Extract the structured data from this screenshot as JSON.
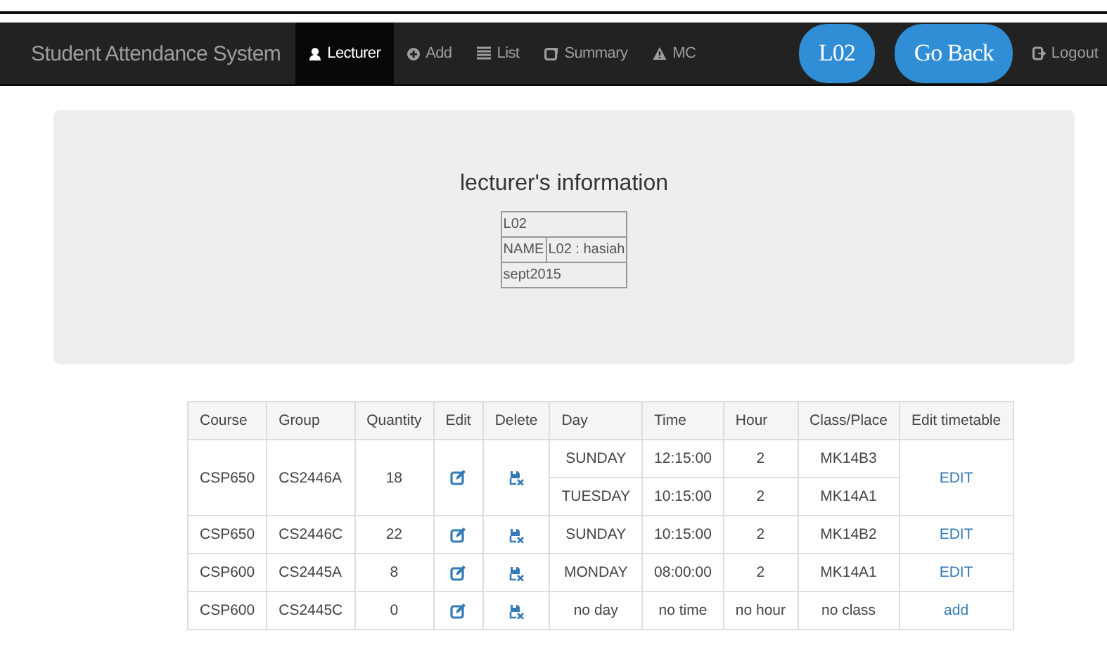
{
  "navbar": {
    "brand": "Student Attendance System",
    "items": [
      {
        "label": "Lecturer",
        "selected": true
      },
      {
        "label": "Add",
        "selected": false
      },
      {
        "label": "List",
        "selected": false
      },
      {
        "label": "Summary",
        "selected": false
      },
      {
        "label": "MC",
        "selected": false
      }
    ],
    "buttons": [
      "L02",
      "Go Back"
    ],
    "logout": "Logout"
  },
  "info": {
    "title": "lecturer's information",
    "id": "L02",
    "name_label": "NAME",
    "name_value": "L02 : hasiah",
    "session": "sept2015"
  },
  "table": {
    "columns": [
      "Course",
      "Group",
      "Quantity",
      "Edit",
      "Delete",
      "Day",
      "Time",
      "Hour",
      "Class/Place",
      "Edit timetable"
    ],
    "rows": [
      {
        "course": "CSP650",
        "group": "CS2446A",
        "quantity": "18",
        "slots": [
          {
            "day": "SUNDAY",
            "time": "12:15:00",
            "hour": "2",
            "place": "MK14B3"
          },
          {
            "day": "TUESDAY",
            "time": "10:15:00",
            "hour": "2",
            "place": "MK14A1"
          }
        ],
        "action": "EDIT"
      },
      {
        "course": "CSP650",
        "group": "CS2446C",
        "quantity": "22",
        "slots": [
          {
            "day": "SUNDAY",
            "time": "10:15:00",
            "hour": "2",
            "place": "MK14B2"
          }
        ],
        "action": "EDIT"
      },
      {
        "course": "CSP600",
        "group": "CS2445A",
        "quantity": "8",
        "slots": [
          {
            "day": "MONDAY",
            "time": "08:00:00",
            "hour": "2",
            "place": "MK14A1"
          }
        ],
        "action": "EDIT"
      },
      {
        "course": "CSP600",
        "group": "CS2445C",
        "quantity": "0",
        "slots": [
          {
            "day": "no day",
            "time": "no time",
            "hour": "no hour",
            "place": "no class"
          }
        ],
        "action": "add"
      }
    ]
  }
}
